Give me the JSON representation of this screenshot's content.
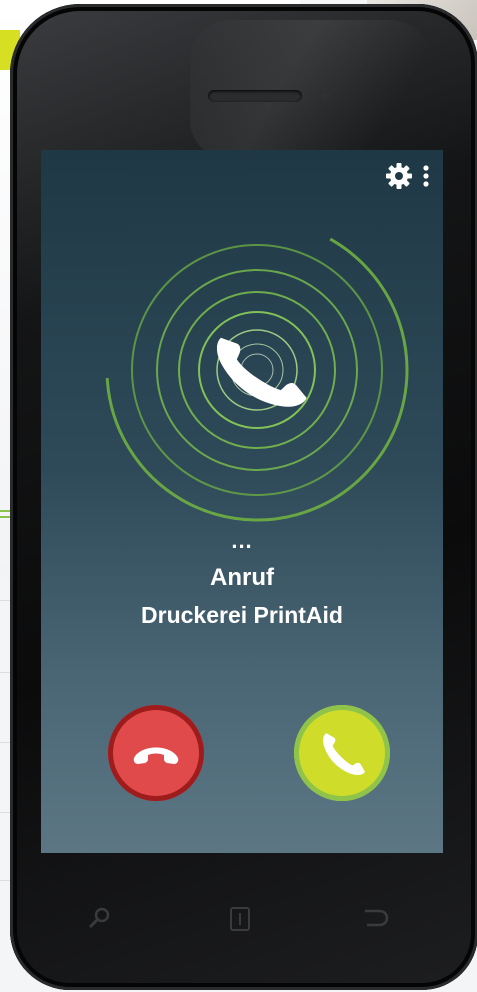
{
  "call": {
    "ellipsis": "...",
    "label": "Anruf",
    "caller": "Druckerei PrintAid"
  },
  "icons": {
    "settings": "gear-icon",
    "menu": "more-vertical-icon",
    "incoming": "phone-handset-icon",
    "decline": "hang-up-icon",
    "accept": "phone-icon",
    "search": "search-key-icon",
    "home": "home-key-icon",
    "back": "back-key-icon"
  },
  "colors": {
    "decline": "#e04a4a",
    "accept": "#cfdc2a",
    "ring": "#6fb043"
  }
}
